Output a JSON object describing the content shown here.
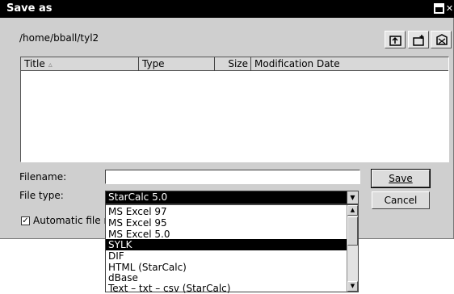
{
  "window": {
    "title": "Save as"
  },
  "path": "/home/bball/tyl2",
  "toolbar": [
    {
      "name": "up-level-icon"
    },
    {
      "name": "new-folder-icon"
    },
    {
      "name": "default-directory-icon"
    }
  ],
  "columns": [
    {
      "label": "Title",
      "sort": "▵"
    },
    {
      "label": "Type"
    },
    {
      "label": "Size"
    },
    {
      "label": "Modification Date"
    }
  ],
  "filename": {
    "label": "Filename:",
    "value": ""
  },
  "filetype": {
    "label": "File type:",
    "value": "StarCalc 5.0"
  },
  "buttons": {
    "save": "Save",
    "cancel": "Cancel"
  },
  "autoext": {
    "label": "Automatic file n",
    "checked": true,
    "mark": "✓"
  },
  "dropdown": {
    "items": [
      "MS Excel 97",
      "MS Excel 95",
      "MS Excel 5.0",
      "SYLK",
      "DIF",
      "HTML (StarCalc)",
      "dBase",
      "Text – txt – csv (StarCalc)"
    ],
    "selected_index": 3
  }
}
